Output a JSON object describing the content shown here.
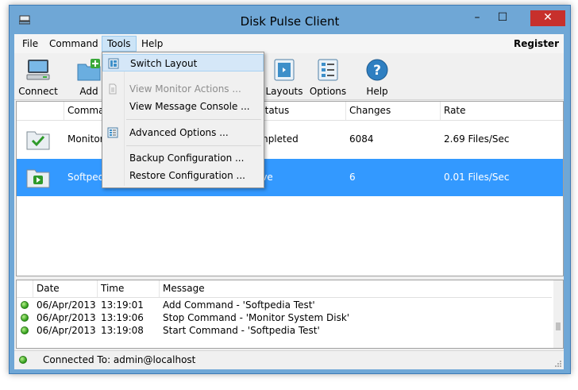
{
  "window": {
    "title": "Disk Pulse Client",
    "minimize_glyph": "–",
    "maximize_glyph": "☐",
    "close_glyph": "✕",
    "accent": "#6fa7d6"
  },
  "menu": {
    "file": "File",
    "command": "Command",
    "tools": "Tools",
    "help": "Help",
    "register": "Register"
  },
  "toolbar": {
    "connect": "Connect",
    "add": "Add",
    "layouts": "Layouts",
    "options": "Options",
    "help": "Help"
  },
  "grid": {
    "columns": [
      "Comma",
      "Status",
      "Changes",
      "Rate"
    ],
    "rows": [
      {
        "command": "Monitor",
        "status": "mpleted",
        "changes": "6084",
        "rate": "2.69 Files/Sec",
        "selected": false
      },
      {
        "command": "Softpedi",
        "status": "ive",
        "changes": "6",
        "rate": "0.01 Files/Sec",
        "selected": true
      }
    ]
  },
  "tools_menu": {
    "items": [
      {
        "label": "Switch Layout",
        "icon": "layout-icon",
        "disabled": false,
        "hover": true
      },
      {
        "label": "View Monitor Actions ...",
        "icon": "document-icon",
        "disabled": true,
        "hover": false
      },
      {
        "label": "View Message Console ...",
        "icon": "",
        "disabled": false,
        "hover": false
      },
      {
        "label": "Advanced Options ...",
        "icon": "options-icon",
        "disabled": false,
        "hover": false
      },
      {
        "label": "Backup Configuration ...",
        "icon": "",
        "disabled": false,
        "hover": false
      },
      {
        "label": "Restore Configuration ...",
        "icon": "",
        "disabled": false,
        "hover": false
      }
    ]
  },
  "log": {
    "columns": [
      "Date",
      "Time",
      "Message"
    ],
    "rows": [
      {
        "date": "06/Apr/2013",
        "time": "13:19:01",
        "message": "Add Command - 'Softpedia Test'"
      },
      {
        "date": "06/Apr/2013",
        "time": "13:19:06",
        "message": "Stop Command - 'Monitor System Disk'"
      },
      {
        "date": "06/Apr/2013",
        "time": "13:19:08",
        "message": "Start Command - 'Softpedia Test'"
      }
    ]
  },
  "status": {
    "text": "Connected To: admin@localhost",
    "color": "#2b9a16"
  }
}
